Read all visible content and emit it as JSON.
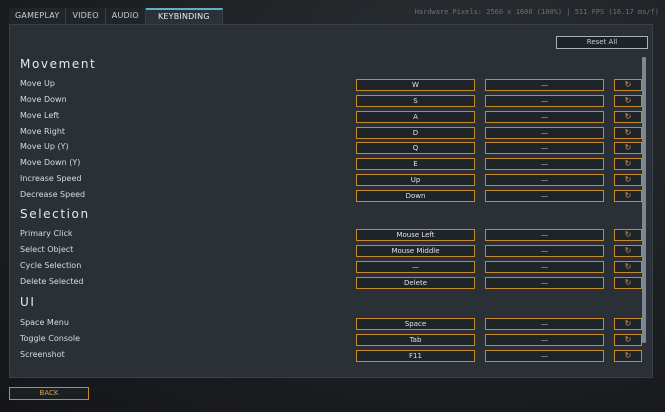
{
  "tabs": [
    {
      "label": "GAMEPLAY"
    },
    {
      "label": "VIDEO"
    },
    {
      "label": "AUDIO"
    },
    {
      "label": "KEYBINDING"
    }
  ],
  "hardware_info": "Hardware Pixels: 2560 x 1600 (100%) | 511 FPS (16.17 ms/f)",
  "reset_all_label": "Reset All",
  "sections": [
    {
      "title": "Movement",
      "rows": [
        {
          "label": "Move Up",
          "primary": "W",
          "secondary": "—"
        },
        {
          "label": "Move Down",
          "primary": "S",
          "secondary": "—"
        },
        {
          "label": "Move Left",
          "primary": "A",
          "secondary": "—"
        },
        {
          "label": "Move Right",
          "primary": "D",
          "secondary": "—"
        },
        {
          "label": "Move Up (Y)",
          "primary": "Q",
          "secondary": "—"
        },
        {
          "label": "Move Down (Y)",
          "primary": "E",
          "secondary": "—"
        },
        {
          "label": "Increase Speed",
          "primary": "Up",
          "secondary": "—"
        },
        {
          "label": "Decrease Speed",
          "primary": "Down",
          "secondary": "—"
        }
      ]
    },
    {
      "title": "Selection",
      "rows": [
        {
          "label": "Primary Click",
          "primary": "Mouse Left",
          "secondary": "—"
        },
        {
          "label": "Select Object",
          "primary": "Mouse Middle",
          "secondary": "—"
        },
        {
          "label": "Cycle Selection",
          "primary": "—",
          "secondary": "—"
        },
        {
          "label": "Delete Selected",
          "primary": "Delete",
          "secondary": "—"
        }
      ]
    },
    {
      "title": "UI",
      "rows": [
        {
          "label": "Space Menu",
          "primary": "Space",
          "secondary": "—"
        },
        {
          "label": "Toggle Console",
          "primary": "Tab",
          "secondary": "—"
        },
        {
          "label": "Screenshot",
          "primary": "F11",
          "secondary": "—"
        }
      ]
    }
  ],
  "reset_row_icon": "reset-icon",
  "back_label": "BACK"
}
